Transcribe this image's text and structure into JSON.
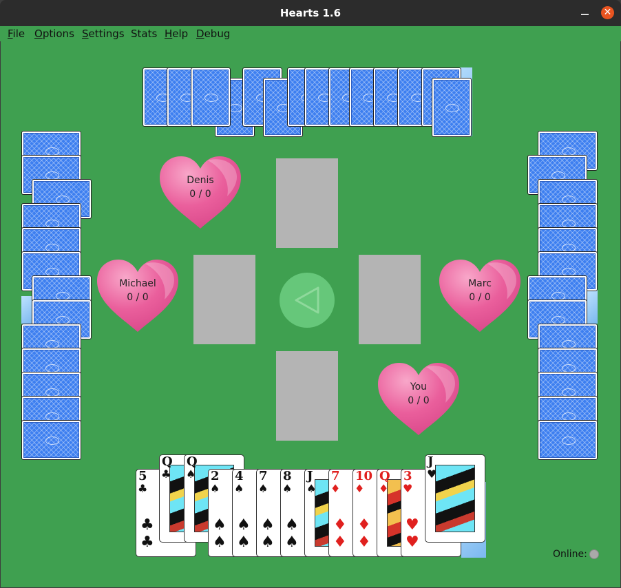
{
  "window": {
    "title": "Hearts 1.6",
    "close_glyph": "✕"
  },
  "menu": {
    "items": [
      {
        "key": "F",
        "rest": "ile"
      },
      {
        "key": "O",
        "rest": "ptions"
      },
      {
        "key": "S",
        "rest": "ettings"
      },
      {
        "key": "",
        "rest": "Stats"
      },
      {
        "key": "H",
        "rest": "elp"
      },
      {
        "key": "D",
        "rest": "ebug"
      }
    ]
  },
  "players": [
    {
      "name": "Denis",
      "score": "0 / 0",
      "seat": "north"
    },
    {
      "name": "Michael",
      "score": "0 / 0",
      "seat": "west"
    },
    {
      "name": "Marc",
      "score": "0 / 0",
      "seat": "east"
    },
    {
      "name": "You",
      "score": "0 / 0",
      "seat": "south"
    }
  ],
  "pass_button": {
    "icon": "left-arrow-icon"
  },
  "hand": [
    {
      "rank": "5",
      "suit": "♣",
      "color": "black"
    },
    {
      "rank": "Q",
      "suit": "♣",
      "color": "black",
      "face": true
    },
    {
      "rank": "Q",
      "suit": "♠",
      "color": "black",
      "face": true
    },
    {
      "rank": "2",
      "suit": "♠",
      "color": "black"
    },
    {
      "rank": "4",
      "suit": "♠",
      "color": "black"
    },
    {
      "rank": "7",
      "suit": "♠",
      "color": "black"
    },
    {
      "rank": "8",
      "suit": "♠",
      "color": "black"
    },
    {
      "rank": "J",
      "suit": "♠",
      "color": "black",
      "face": true
    },
    {
      "rank": "7",
      "suit": "♦",
      "color": "red"
    },
    {
      "rank": "10",
      "suit": "♦",
      "color": "red"
    },
    {
      "rank": "Q",
      "suit": "♦",
      "color": "red",
      "face": true
    },
    {
      "rank": "3",
      "suit": "♥",
      "color": "red"
    },
    {
      "rank": "J",
      "suit": "♥",
      "color": "black",
      "face": true
    }
  ],
  "status": {
    "online_label": "Online:"
  },
  "colors": {
    "felt": "#3fa050",
    "heart": "#ea5f9c",
    "slot": "#b4b4b4",
    "card_back": "#3d7ff0"
  }
}
